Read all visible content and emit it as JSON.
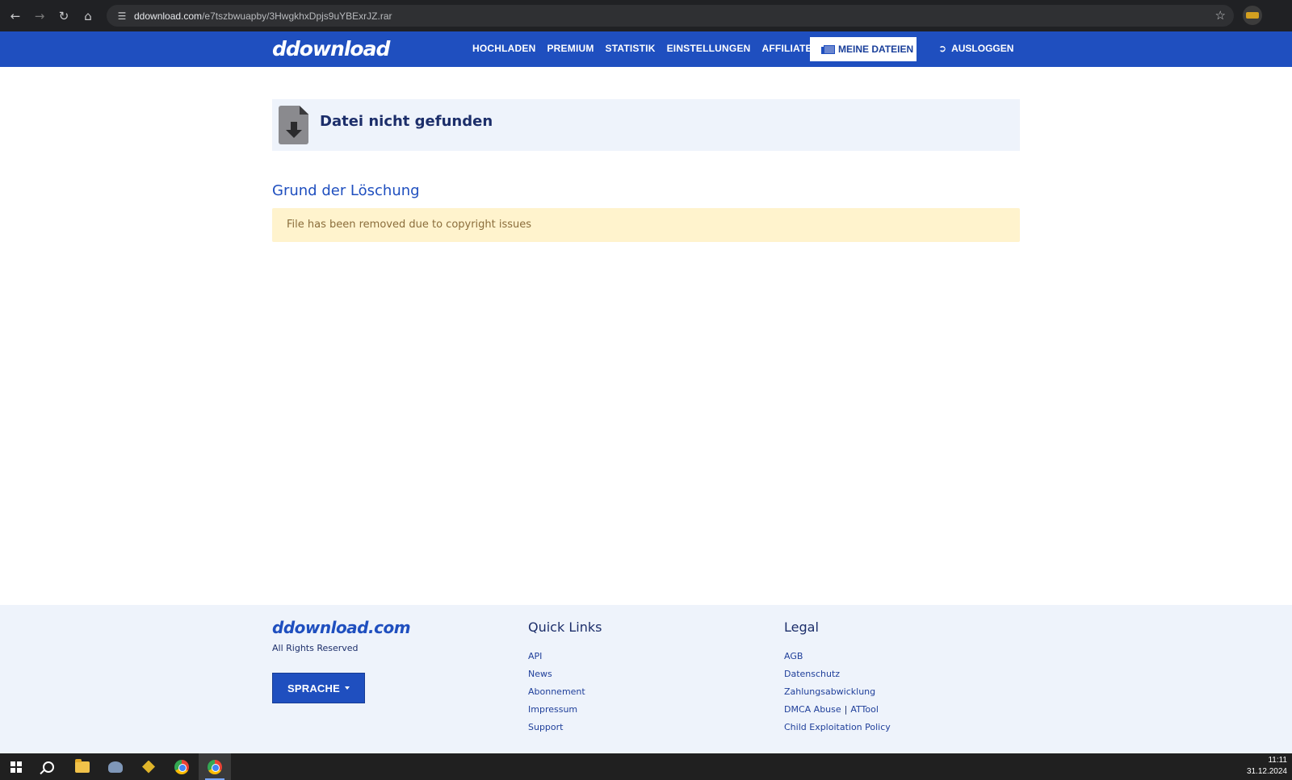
{
  "browser": {
    "url_host": "ddownload.com",
    "url_path": "/e7tszbwuapby/3HwgkhxDpjs9uYBExrJZ.rar",
    "icons": {
      "back": "back-arrow-icon",
      "forward": "forward-arrow-icon",
      "reload": "reload-icon",
      "home": "home-icon",
      "site_settings": "tune-icon",
      "bookmark": "star-icon"
    }
  },
  "header": {
    "logo": "ddownload",
    "nav": [
      "HOCHLADEN",
      "PREMIUM",
      "STATISTIK",
      "EINSTELLUNGEN",
      "AFFILIATE"
    ],
    "my_files_label": "MEINE DATEIEN",
    "logout_label": "AUSLOGGEN",
    "colors": {
      "brand": "#1f4fbf"
    }
  },
  "main": {
    "notfound_title": "Datei nicht gefunden",
    "reason_heading": "Grund der Löschung",
    "reason_text": "File has been removed due to copyright issues"
  },
  "footer": {
    "logo": "ddownload.com",
    "rights": "All Rights Reserved",
    "language_button": "SPRACHE",
    "quick_links": {
      "title": "Quick Links",
      "items": [
        "API",
        "News",
        "Abonnement",
        "Impressum",
        "Support"
      ]
    },
    "legal": {
      "title": "Legal",
      "items": [
        "AGB",
        "Datenschutz",
        "Zahlungsabwicklung",
        "DMCA Abuse",
        "ATTool",
        "Child Exploitation Policy"
      ]
    }
  },
  "taskbar": {
    "time": "11:11",
    "date": "31.12.2024"
  }
}
